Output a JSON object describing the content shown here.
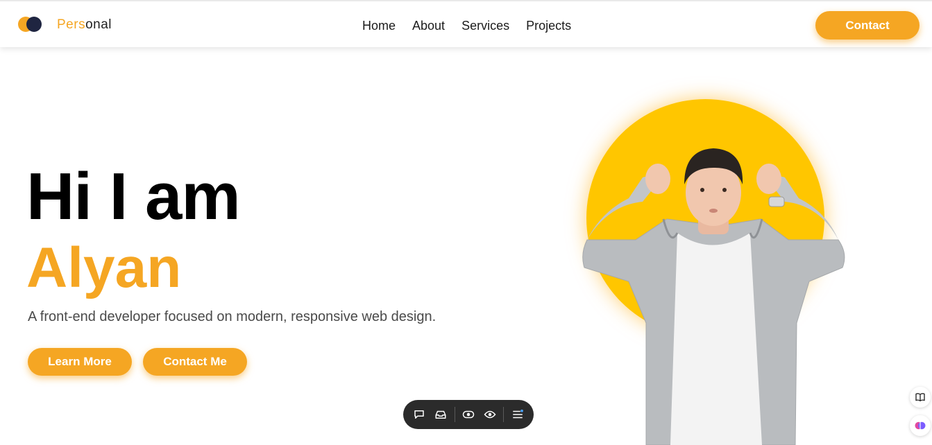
{
  "header": {
    "brand_part1": "Pers",
    "brand_part2": "onal",
    "nav": [
      "Home",
      "About",
      "Services",
      "Projects"
    ],
    "contact_label": "Contact"
  },
  "hero": {
    "title": "Hi I am",
    "name": "Alyan",
    "subtitle": "A front-end developer focused on modern, responsive web design.",
    "learn_more_label": "Learn More",
    "contact_me_label": "Contact Me"
  },
  "toolbar": {
    "icons": [
      "comment-icon",
      "inbox-icon",
      "eye-toggle-icon",
      "eye-icon",
      "menu-icon"
    ]
  },
  "side_buttons": [
    "book-icon",
    "brain-icon"
  ],
  "colors": {
    "accent": "#f5a623",
    "portrait_bg": "#ffc600",
    "logo_dark": "#1f2541",
    "toolbar_bg": "#2b2b2b"
  }
}
